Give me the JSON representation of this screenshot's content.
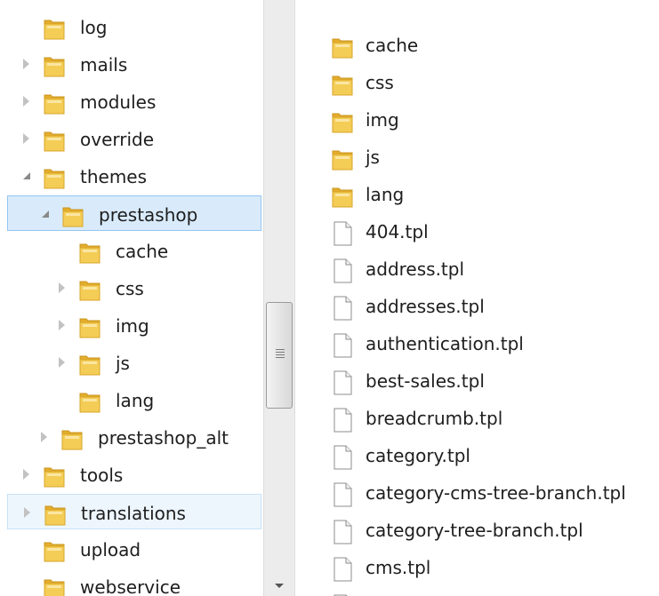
{
  "tree": [
    {
      "label": "log",
      "indent": 0,
      "arrow": "none",
      "state": ""
    },
    {
      "label": "mails",
      "indent": 0,
      "arrow": "collapsed",
      "state": ""
    },
    {
      "label": "modules",
      "indent": 0,
      "arrow": "collapsed",
      "state": ""
    },
    {
      "label": "override",
      "indent": 0,
      "arrow": "collapsed",
      "state": ""
    },
    {
      "label": "themes",
      "indent": 0,
      "arrow": "expanded",
      "state": ""
    },
    {
      "label": "prestashop",
      "indent": 1,
      "arrow": "expanded",
      "state": "selected"
    },
    {
      "label": "cache",
      "indent": 2,
      "arrow": "none",
      "state": ""
    },
    {
      "label": "css",
      "indent": 2,
      "arrow": "collapsed",
      "state": ""
    },
    {
      "label": "img",
      "indent": 2,
      "arrow": "collapsed",
      "state": ""
    },
    {
      "label": "js",
      "indent": 2,
      "arrow": "collapsed",
      "state": ""
    },
    {
      "label": "lang",
      "indent": 2,
      "arrow": "none",
      "state": ""
    },
    {
      "label": "prestashop_alt",
      "indent": 1,
      "arrow": "collapsed",
      "state": ""
    },
    {
      "label": "tools",
      "indent": 0,
      "arrow": "collapsed",
      "state": ""
    },
    {
      "label": "translations",
      "indent": 0,
      "arrow": "collapsed",
      "state": "hovered"
    },
    {
      "label": "upload",
      "indent": 0,
      "arrow": "none",
      "state": ""
    },
    {
      "label": "webservice",
      "indent": 0,
      "arrow": "none",
      "state": ""
    }
  ],
  "files": [
    {
      "label": "cache",
      "type": "folder"
    },
    {
      "label": "css",
      "type": "folder"
    },
    {
      "label": "img",
      "type": "folder"
    },
    {
      "label": "js",
      "type": "folder"
    },
    {
      "label": "lang",
      "type": "folder"
    },
    {
      "label": "404.tpl",
      "type": "file"
    },
    {
      "label": "address.tpl",
      "type": "file"
    },
    {
      "label": "addresses.tpl",
      "type": "file"
    },
    {
      "label": "authentication.tpl",
      "type": "file"
    },
    {
      "label": "best-sales.tpl",
      "type": "file"
    },
    {
      "label": "breadcrumb.tpl",
      "type": "file"
    },
    {
      "label": "category.tpl",
      "type": "file"
    },
    {
      "label": "category-cms-tree-branch.tpl",
      "type": "file"
    },
    {
      "label": "category-tree-branch.tpl",
      "type": "file"
    },
    {
      "label": "cms.tpl",
      "type": "file"
    },
    {
      "label": "",
      "type": "file"
    }
  ],
  "icons": {
    "folder": "folder-icon",
    "file": "file-icon"
  },
  "colors": {
    "selection": "#d9ebfb",
    "selection_border": "#95c6f2",
    "hover": "#eef6fd",
    "folder_yellow": "#f2c94c"
  }
}
